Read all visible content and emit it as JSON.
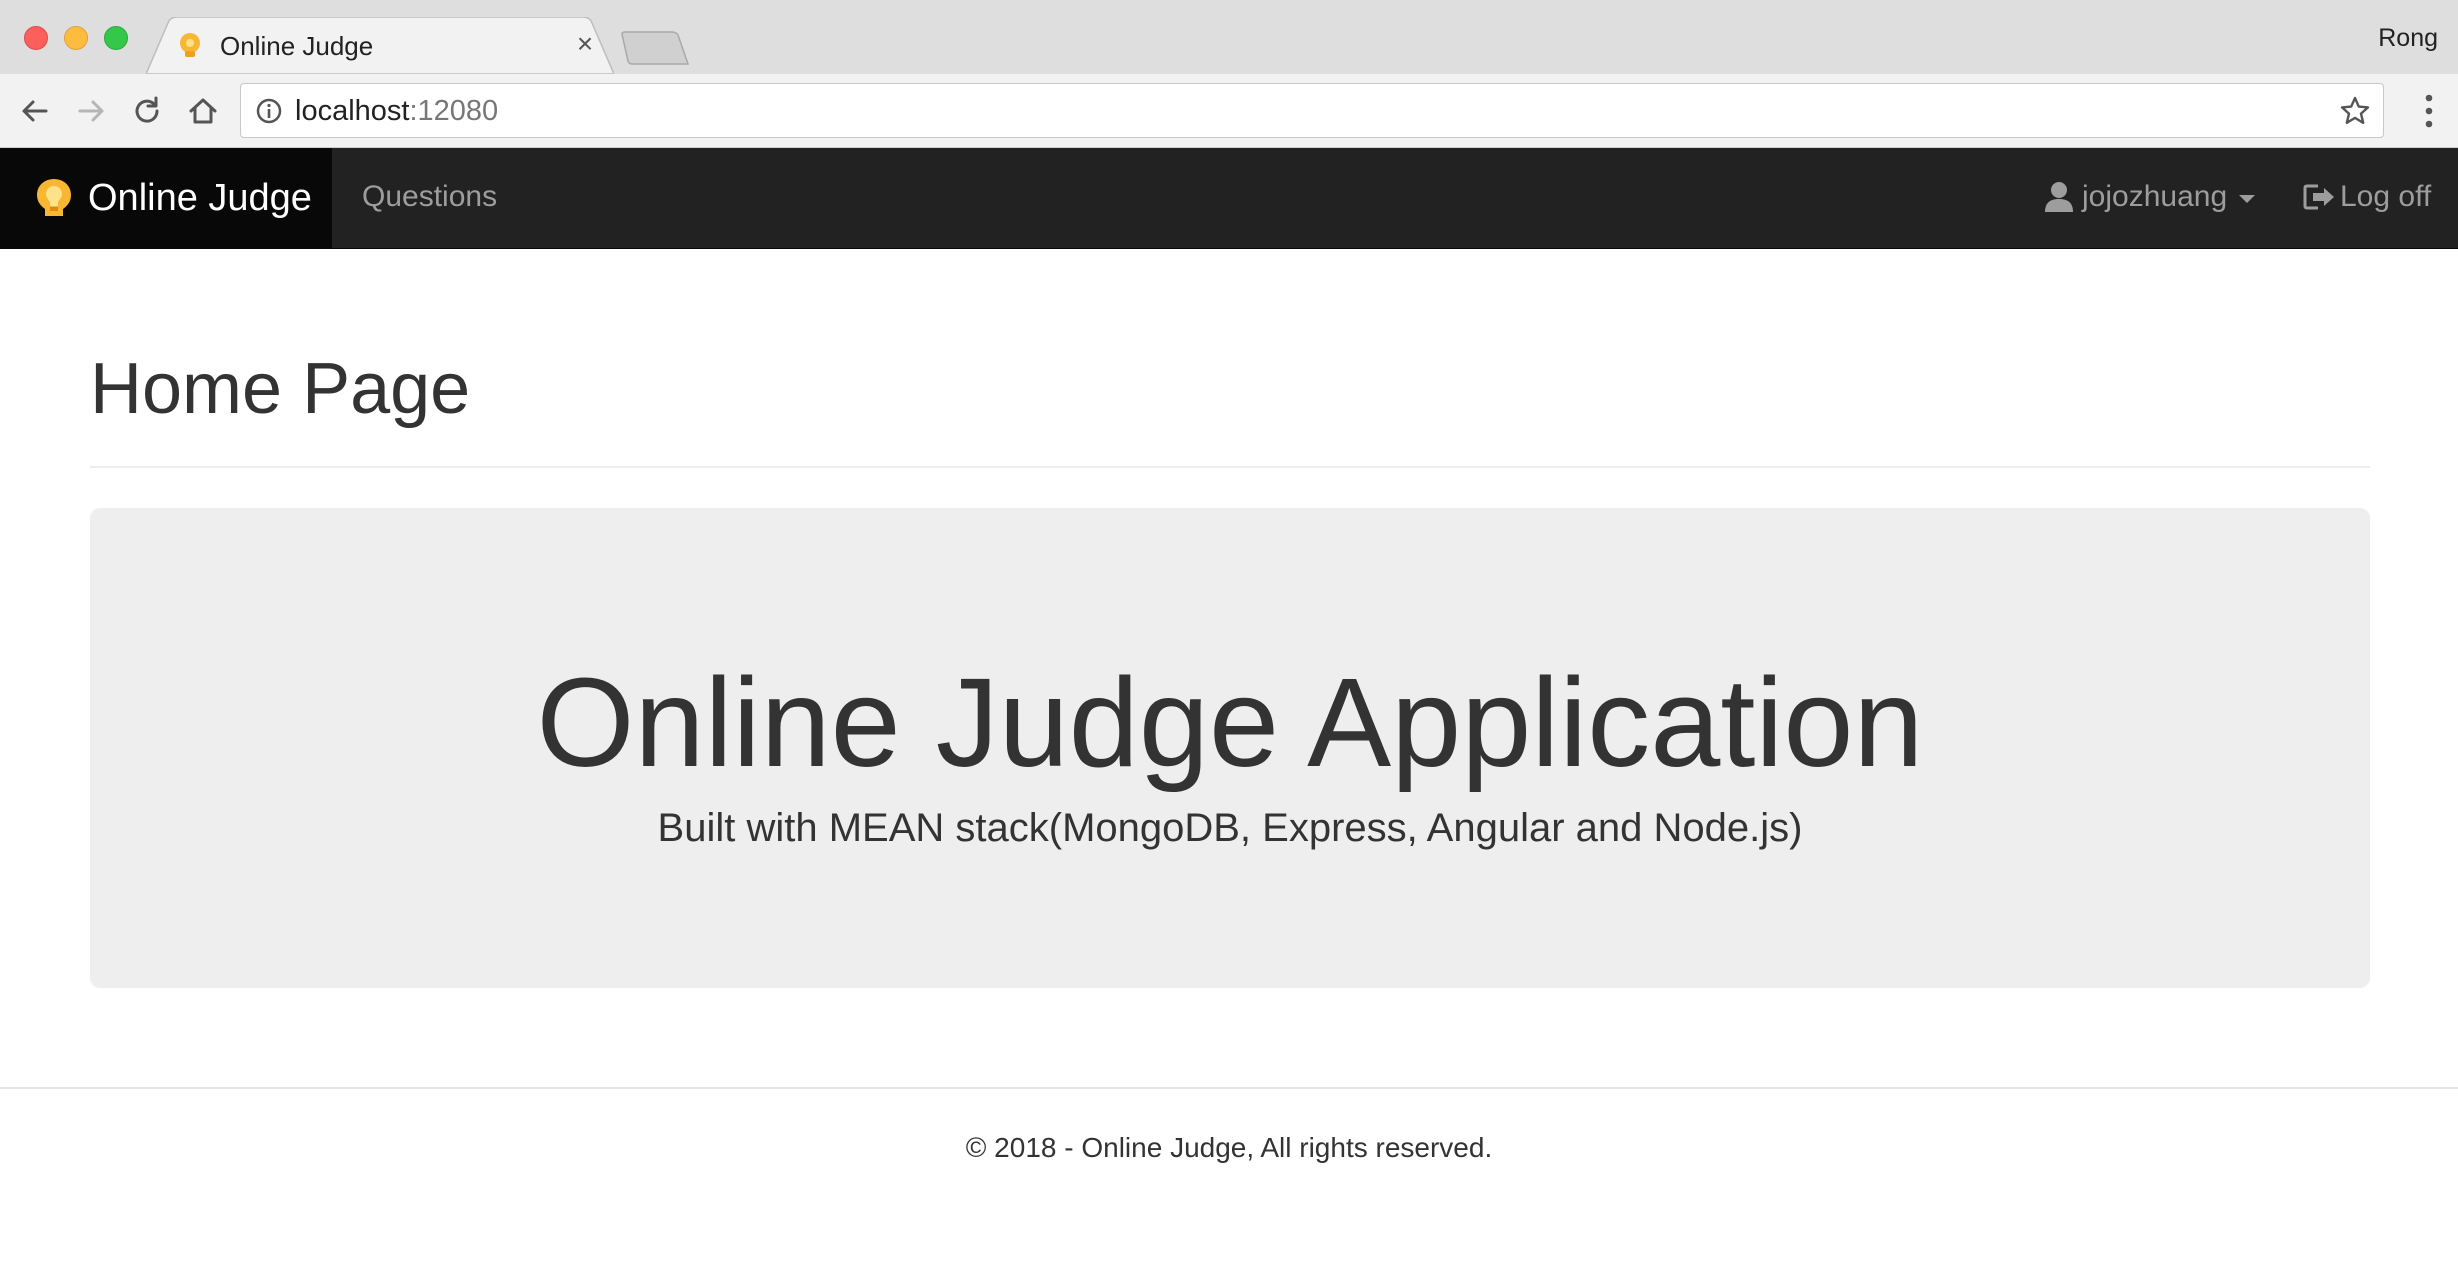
{
  "browser": {
    "tab_title": "Online Judge",
    "tab_close": "×",
    "profile_name": "Rong",
    "url_host": "localhost",
    "url_port": ":12080"
  },
  "navbar": {
    "brand": "Online Judge",
    "questions": "Questions",
    "username": "jojozhuang",
    "logoff": "Log off"
  },
  "page": {
    "title": "Home Page",
    "jumbotron_title": "Online Judge Application",
    "jumbotron_subtitle": "Built with MEAN stack(MongoDB, Express, Angular and Node.js)"
  },
  "footer": {
    "text": "© 2018 - Online Judge, All rights reserved."
  },
  "icons": {
    "brand": "lightbulb-head-icon",
    "user": "user-icon",
    "logoff": "log-out-icon"
  },
  "colors": {
    "navbar_bg": "#222222",
    "brand_bg": "#080808",
    "nav_link": "#9d9d9d",
    "jumbotron_bg": "#eeeeee",
    "text": "#333333"
  }
}
